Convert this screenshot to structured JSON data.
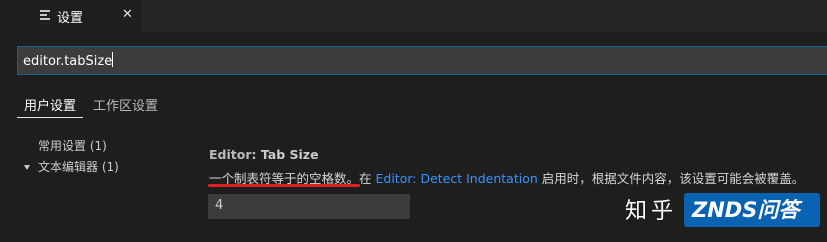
{
  "tab": {
    "label": "设置",
    "close": "✕"
  },
  "search": {
    "value": "editor.tabSize"
  },
  "scopes": {
    "user": "用户设置",
    "workspace": "工作区设置"
  },
  "toc": {
    "items": [
      {
        "label": "常用设置 (1)",
        "expanded": false
      },
      {
        "label": "文本编辑器 (1)",
        "expanded": true
      }
    ]
  },
  "setting": {
    "category": "Editor: ",
    "name": "Tab Size",
    "desc_before": "一个制表符等于的空格数。在 ",
    "desc_link": "Editor: Detect Indentation",
    "desc_after": " 启用时，根据文件内容，该设置可能会被覆盖。",
    "value": "4"
  },
  "watermarks": {
    "zhihu": "知乎",
    "znds": "ZNDS问答"
  },
  "colors": {
    "background": "#1e1e1e",
    "link": "#3794ff",
    "highlight_underline": "#e02020",
    "input_border": "#0e639c"
  }
}
